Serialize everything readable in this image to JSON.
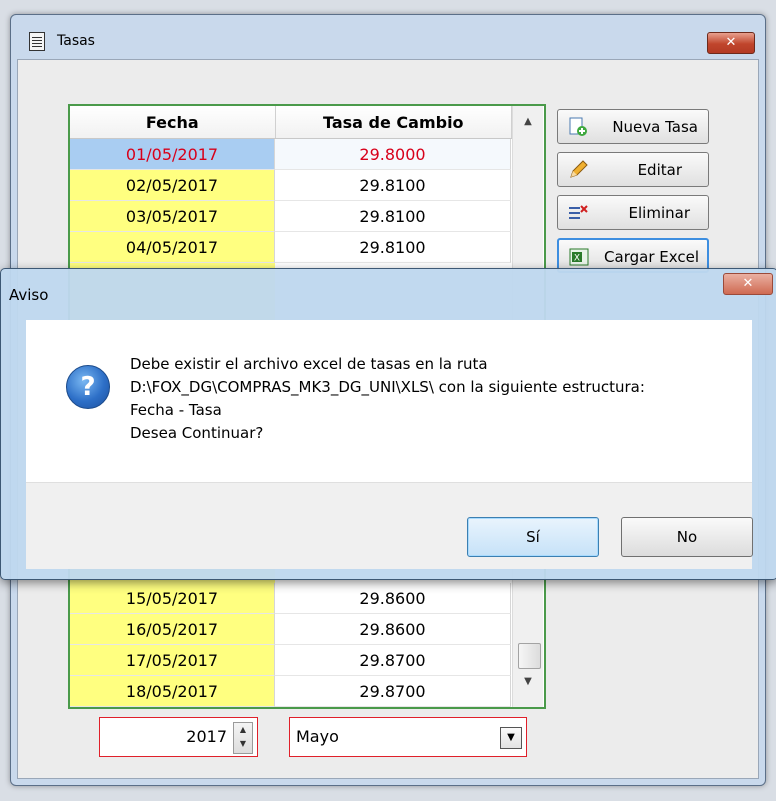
{
  "window": {
    "title": "Tasas"
  },
  "grid": {
    "headers": [
      "Fecha",
      "Tasa de Cambio"
    ],
    "rows": [
      {
        "fecha": "01/05/2017",
        "tasa": "29.8000"
      },
      {
        "fecha": "02/05/2017",
        "tasa": "29.8100"
      },
      {
        "fecha": "03/05/2017",
        "tasa": "29.8100"
      },
      {
        "fecha": "04/05/2017",
        "tasa": "29.8100"
      },
      {
        "fecha": "15/05/2017",
        "tasa": "29.8600"
      },
      {
        "fecha": "16/05/2017",
        "tasa": "29.8600"
      },
      {
        "fecha": "17/05/2017",
        "tasa": "29.8700"
      },
      {
        "fecha": "18/05/2017",
        "tasa": "29.8700"
      }
    ]
  },
  "buttons": {
    "nueva": "Nueva Tasa",
    "editar": "Editar",
    "eliminar": "Eliminar",
    "cargar": "Cargar Excel"
  },
  "filters": {
    "year": "2017",
    "month": "Mayo"
  },
  "dialog": {
    "title": "Aviso",
    "lines": [
      "Debe existir el archivo excel de tasas en la ruta",
      "D:\\FOX_DG\\COMPRAS_MK3_DG_UNI\\XLS\\ con la siguiente estructura:",
      "Fecha - Tasa",
      "Desea Continuar?"
    ],
    "yes": "Sí",
    "no": "No"
  },
  "colors": {
    "selected_row": "#a9cdf2",
    "date_cells": "#ffff80",
    "selected_text": "#d8001a",
    "grid_border": "#4a9a4a",
    "required_border": "#e0202a"
  }
}
